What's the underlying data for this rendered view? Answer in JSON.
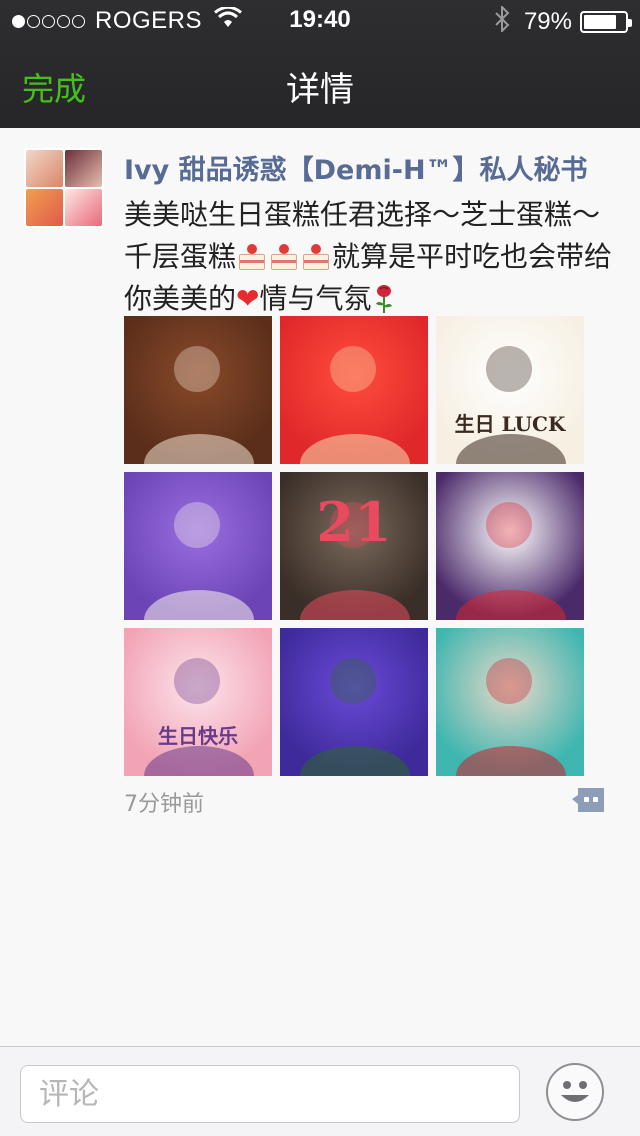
{
  "status_bar": {
    "signal_filled": 1,
    "signal_total": 5,
    "carrier": "ROGERS",
    "time": "19:40",
    "battery_text": "79%",
    "battery_level": 0.79
  },
  "nav": {
    "back_label": "完成",
    "title": "详情"
  },
  "post": {
    "username": "Ivy 甜品诱惑【Demi-H™】私人秘书",
    "text_part1": "美美哒生日蛋糕任君选择～芝士蛋糕～千层蛋糕",
    "text_part2": "就算是平时吃也会带给你美美的",
    "text_part3": "情与气氛",
    "emoji": {
      "cake": "shortcake-emoji",
      "heart": "heart-emoji",
      "rose": "rose-emoji"
    },
    "photos": [
      {
        "name": "chocolate-monkey-cake",
        "c1": "#5a2e1a",
        "c2": "#8a4a2a",
        "accent": "#f4e6d6"
      },
      {
        "name": "strawberry-cheesecake",
        "c1": "#e0282a",
        "c2": "#ff4d3d",
        "accent": "#f6dcb0"
      },
      {
        "name": "smiley-face-cake",
        "c1": "#f6efe2",
        "c2": "#ffffff",
        "accent": "#3b2a20",
        "caption": "生日 LUCK"
      },
      {
        "name": "purple-rose-cake",
        "c1": "#6d44b6",
        "c2": "#9a6fe0",
        "accent": "#f8f4ec"
      },
      {
        "name": "number-21-candle-cake",
        "c1": "#3a2e28",
        "c2": "#7b6a5c",
        "accent": "#e84a5f",
        "caption": "21"
      },
      {
        "name": "strawberry-rose-cake",
        "c1": "#4b2a6a",
        "c2": "#ffffff",
        "accent": "#d9262f"
      },
      {
        "name": "pink-birthday-cake",
        "c1": "#f2a3b4",
        "c2": "#fce4ec",
        "accent": "#6a3a8a",
        "caption": "生日快乐"
      },
      {
        "name": "purple-heart-cake",
        "c1": "#3e2a9a",
        "c2": "#6a4ad8",
        "accent": "#2c6a2a"
      },
      {
        "name": "teal-layer-cake-slice",
        "c1": "#3fb6b0",
        "c2": "#e8d8c8",
        "accent": "#c9202a"
      }
    ],
    "time_ago": "7分钟前"
  },
  "comment_bar": {
    "placeholder": "评论"
  },
  "colors": {
    "accent_green": "#45c01a",
    "link_blue": "#576b95",
    "header_bg": "#2a2a2d"
  }
}
